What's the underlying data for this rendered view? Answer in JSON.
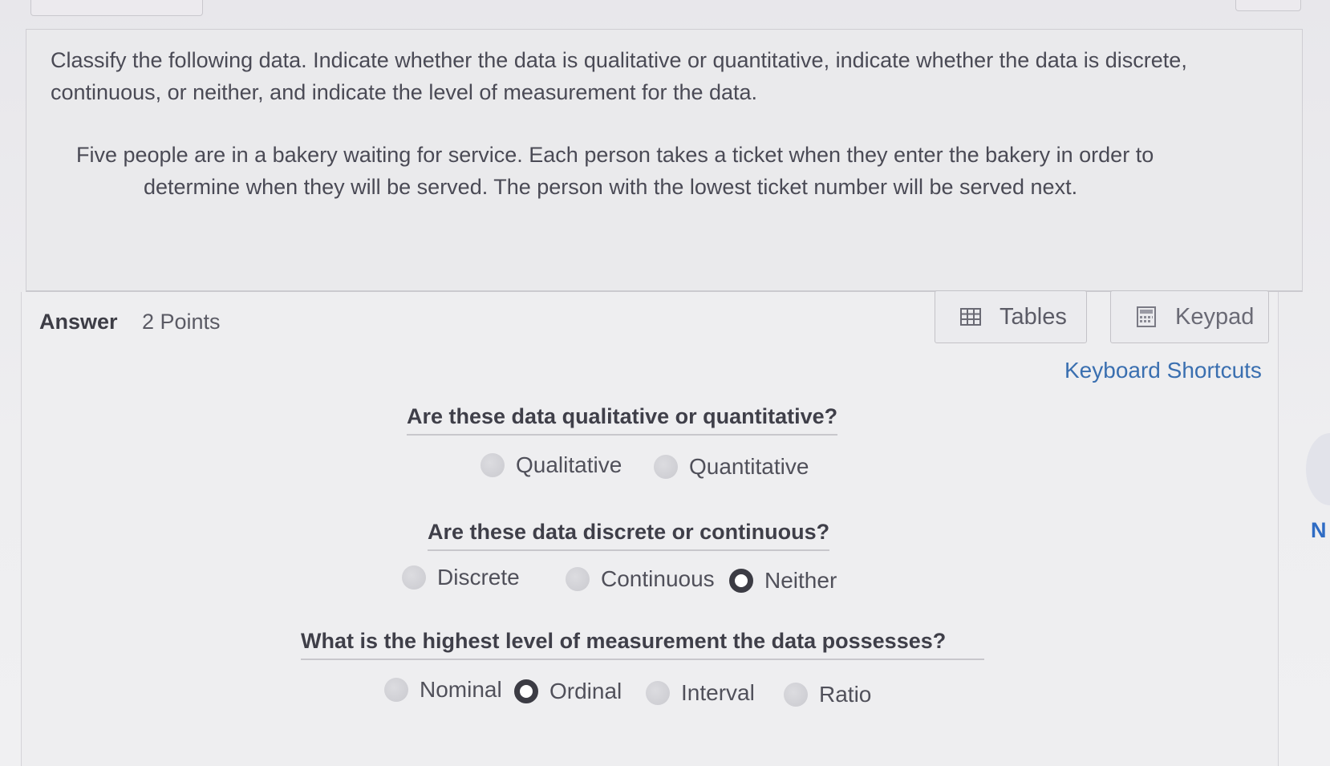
{
  "question": {
    "instructions": "Classify the following data. Indicate whether the data is qualitative or quantitative, indicate whether the data is discrete, continuous, or neither, and indicate the level of measurement for the data.",
    "scenario_line1": "Five people are in a bakery waiting for service. Each person takes a ticket when they enter the bakery in order to",
    "scenario_line2": "determine when they will be served. The person with the lowest ticket number will be served next."
  },
  "answer": {
    "label": "Answer",
    "points": "2 Points",
    "tables_label": "Tables",
    "keypad_label": "Keypad",
    "shortcuts_label": "Keyboard Shortcuts"
  },
  "q1": {
    "heading": "Are these data qualitative or quantitative?",
    "options": [
      "Qualitative",
      "Quantitative"
    ],
    "selected": null
  },
  "q2": {
    "heading": "Are these data discrete or continuous?",
    "options": [
      "Discrete",
      "Continuous",
      "Neither"
    ],
    "selected": "Neither"
  },
  "q3": {
    "heading": "What is the highest level of measurement the data possesses?",
    "options": [
      "Nominal",
      "Ordinal",
      "Interval",
      "Ratio"
    ],
    "selected": "Ordinal"
  },
  "side_letter": "N",
  "icons": {
    "tables": "table-grid-icon",
    "keypad": "calculator-icon"
  },
  "colors": {
    "link": "#3a6fb0",
    "side_letter": "#2f6cc4"
  }
}
